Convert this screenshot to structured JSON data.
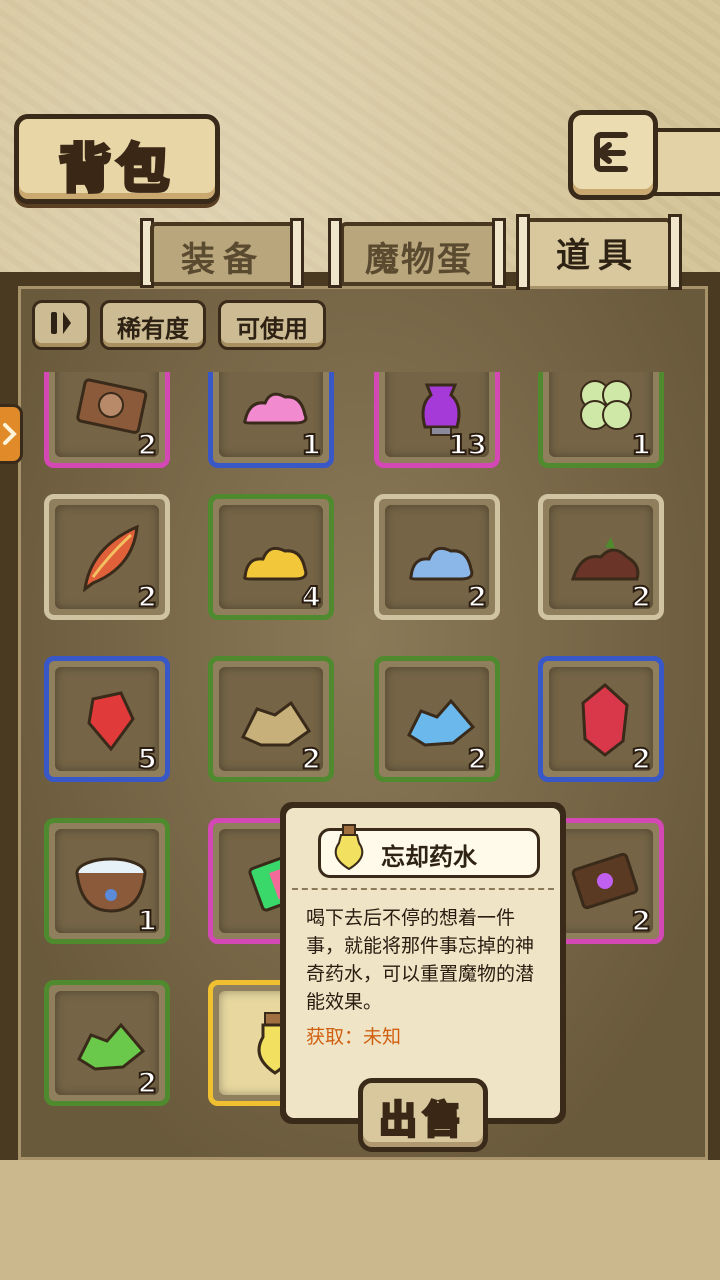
{
  "header": {
    "title": "背包"
  },
  "tabs": [
    {
      "label": "装备",
      "active": false
    },
    {
      "label": "魔物蛋",
      "active": false
    },
    {
      "label": "道具",
      "active": true
    }
  ],
  "filters": {
    "sort_icon": "pause-sort-icon",
    "rarity": "稀有度",
    "usable": "可使用"
  },
  "items": [
    {
      "icon": "scroll-card-icon",
      "count": "2",
      "rarity": "pink"
    },
    {
      "icon": "pink-slime-icon",
      "count": "1",
      "rarity": "blue"
    },
    {
      "icon": "purple-potion-vase-icon",
      "count": "13",
      "rarity": "pink"
    },
    {
      "icon": "four-leaf-clover-icon",
      "count": "1",
      "rarity": "green"
    },
    {
      "icon": "phoenix-feather-icon",
      "count": "2",
      "rarity": "tan"
    },
    {
      "icon": "yellow-slime-icon",
      "count": "4",
      "rarity": "green"
    },
    {
      "icon": "blue-slime-icon",
      "count": "2",
      "rarity": "tan"
    },
    {
      "icon": "dirt-pile-icon",
      "count": "2",
      "rarity": "tan"
    },
    {
      "icon": "red-gem-shard-icon",
      "count": "5",
      "rarity": "blue"
    },
    {
      "icon": "gold-ore-icon",
      "count": "2",
      "rarity": "green"
    },
    {
      "icon": "ice-crystal-icon",
      "count": "2",
      "rarity": "green"
    },
    {
      "icon": "red-crystal-icon",
      "count": "2",
      "rarity": "blue"
    },
    {
      "icon": "water-bowl-icon",
      "count": "1",
      "rarity": "green"
    },
    {
      "icon": "rainbow-block-icon",
      "count": "",
      "rarity": "pink"
    },
    {
      "icon": "hidden-slot",
      "count": "",
      "rarity": "tan"
    },
    {
      "icon": "magic-book-icon",
      "count": "2",
      "rarity": "pink"
    },
    {
      "icon": "green-crystal-icon",
      "count": "2",
      "rarity": "green"
    },
    {
      "icon": "forget-potion-icon",
      "count": "",
      "rarity": "gold"
    }
  ],
  "popup": {
    "name": "忘却药水",
    "description": "喝下去后不停的想着一件事，就能将那件事忘掉的神奇药水，可以重置魔物的潜能效果。",
    "source": "获取：未知",
    "sell": "出售"
  }
}
